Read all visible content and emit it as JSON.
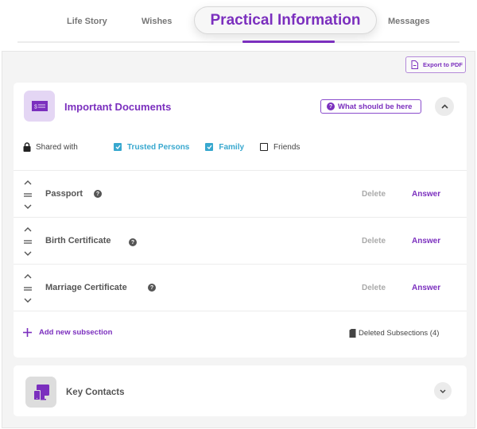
{
  "tabs": {
    "items": [
      {
        "label": "Life Story"
      },
      {
        "label": "Wishes"
      },
      {
        "label": "Practical Information",
        "active": true
      },
      {
        "label": "Messages"
      }
    ]
  },
  "toolbar": {
    "export_label": "Export to PDF",
    "export_icon": "document-icon"
  },
  "sections": {
    "documents": {
      "title": "Important Documents",
      "icon": "id-card-icon",
      "help_label": "What should be here",
      "help_icon": "question-icon",
      "collapse_icon": "chevron-up-icon",
      "shared": {
        "label": "Shared with",
        "icon": "lock-icon",
        "options": [
          {
            "label": "Trusted Persons",
            "checked": true
          },
          {
            "label": "Family",
            "checked": true
          },
          {
            "label": "Friends",
            "checked": false
          }
        ]
      },
      "subsections": [
        {
          "label": "Passport",
          "delete_label": "Delete",
          "answer_label": "Answer"
        },
        {
          "label": "Birth Certificate",
          "delete_label": "Delete",
          "answer_label": "Answer"
        },
        {
          "label": "Marriage Certificate",
          "delete_label": "Delete",
          "answer_label": "Answer"
        }
      ],
      "add_label": "Add new subsection",
      "deleted_label": "Deleted Subsections (4)"
    },
    "contacts": {
      "title": "Key Contacts",
      "icon": "devices-icon",
      "expand_icon": "chevron-down-icon"
    }
  },
  "colors": {
    "accent": "#7b2fbe",
    "checkbox": "#38a8cf",
    "panel_bg": "#f4f4f4"
  }
}
